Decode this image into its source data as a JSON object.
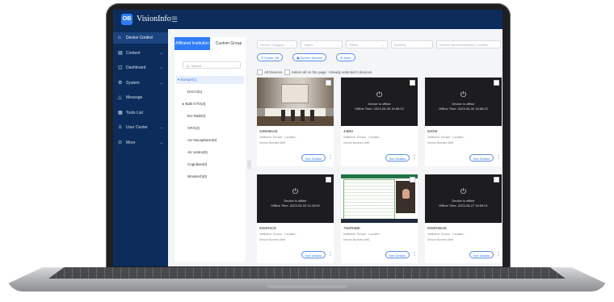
{
  "app": {
    "logo_text": "OB",
    "title": "VisionInfo",
    "menu_toggle": "☰"
  },
  "sidebar": {
    "items": [
      {
        "icon": "⌂",
        "label": "Device Control",
        "chevron": ""
      },
      {
        "icon": "▤",
        "label": "Content",
        "chevron": "⌄"
      },
      {
        "icon": "◫",
        "label": "Dashboard",
        "chevron": "⌄"
      },
      {
        "icon": "⚙",
        "label": "System",
        "chevron": "⌄"
      },
      {
        "icon": "△",
        "label": "Message",
        "chevron": ""
      },
      {
        "icon": "▦",
        "label": "Tools List",
        "chevron": ""
      },
      {
        "icon": "♙",
        "label": "User Center",
        "chevron": "⌄"
      },
      {
        "icon": "⊙",
        "label": "More",
        "chevron": "⌄"
      }
    ]
  },
  "tree": {
    "tabs": [
      "Affiliated Institution",
      "Custom Group"
    ],
    "search_placeholder": "Q. Search",
    "items": [
      {
        "label": "▾ Europe(1)"
      },
      {
        "label": "DACH(1)"
      },
      {
        "label": "▸ B2B GTO(4)"
      },
      {
        "label": "EU R&D(0)"
      },
      {
        "label": "CRX(2)"
      },
      {
        "label": "AU Nocapharm(0)"
      },
      {
        "label": "AV centro(0)"
      },
      {
        "label": "Cognitive(0)"
      },
      {
        "label": "Wonitech(0)"
      }
    ],
    "collapse_glyph": "‹"
  },
  "filters": [
    {
      "label": "Device Category",
      "dd": "⌄"
    },
    {
      "label": "Status",
      "dd": "⌄"
    },
    {
      "label": "Status",
      "dd": "⌄"
    },
    {
      "label": "Building",
      "dd": ""
    },
    {
      "label": "Device Name/Installation Location",
      "dd": ""
    }
  ],
  "actions": {
    "power_off": "⏻ Power Off",
    "screen_monitor": "▣ Screen Monitor",
    "more": "⊕ More"
  },
  "selection": {
    "all_devices": "All Devices",
    "select_all": "Select all on the page",
    "already_selected": "Already selected 0 devices"
  },
  "cards": [
    {
      "thumb": "room",
      "offline": "",
      "offline_time": "",
      "name": "32BM66AE",
      "inst": "Institution: Europe",
      "loc": "Location: -",
      "owner": "Device Bunnies Well",
      "see_details": "See Details",
      "kebab": "⋮"
    },
    {
      "thumb": "offline",
      "offline": "Device is offline",
      "offline_time": "Offline Time: 2023-05-30 16:56:22",
      "name": "43BM",
      "inst": "Institution: Europe",
      "loc": "Location: -",
      "owner": "Device Bunnies Well",
      "see_details": "See Details",
      "kebab": "⋮"
    },
    {
      "thumb": "offline",
      "offline": "Device is offline",
      "offline_time": "Offline Time: 2023-05-30 16:56:22",
      "name": "50GM",
      "inst": "Institution: Europe",
      "loc": "Location: -",
      "owner": "Device Bunnies Well",
      "see_details": "See Details",
      "kebab": "⋮"
    },
    {
      "thumb": "offline",
      "offline": "Device is offline",
      "offline_time": "Offline Time: 2023-05-03 11:43:00",
      "name": "65WR6CE",
      "inst": "Institution: Europe",
      "loc": "Location: -",
      "owner": "Device Bunnies Well",
      "see_details": "See Details",
      "kebab": "⋮"
    },
    {
      "thumb": "sheet",
      "offline": "",
      "offline_time": "",
      "name": "75WR6BE",
      "inst": "Institution: Europe",
      "loc": "Location: -",
      "owner": "Device Bunnies Well",
      "see_details": "See Details",
      "kebab": "⋮"
    },
    {
      "thumb": "offline",
      "offline": "Device is offline",
      "offline_time": "Offline Time: 2023-06-27 16:59:01",
      "name": "86WR6BAE",
      "inst": "Institution: Europe",
      "loc": "Location: -",
      "owner": "Device Bunnies Well",
      "see_details": "See Details",
      "kebab": "⋮"
    }
  ],
  "colors": {
    "sidebar": "#0c2d5c",
    "accent": "#2f7df6"
  }
}
